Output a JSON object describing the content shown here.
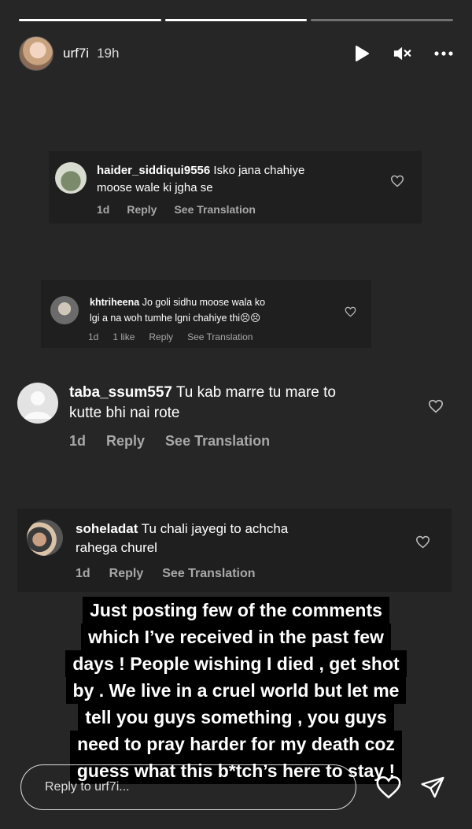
{
  "story": {
    "progress": [
      1.0,
      1.0,
      0.0
    ],
    "username": "urf7i",
    "time": "19h"
  },
  "comments": [
    {
      "user": "haider_siddiqui9556",
      "text1": "Isko jana chahiye",
      "text2": "moose wale ki jgha se",
      "time": "1d",
      "likes": "",
      "reply": "Reply",
      "translate": "See Translation"
    },
    {
      "user": "khtriheena",
      "text1": "Jo goli sidhu moose wala ko",
      "text2": "lgi a na woh tumhe lgni chahiye thi😣😣",
      "time": "1d",
      "likes": "1 like",
      "reply": "Reply",
      "translate": "See Translation"
    },
    {
      "user": "taba_ssum557",
      "text1": "Tu kab marre tu mare to",
      "text2": "kutte bhi nai rote",
      "time": "1d",
      "likes": "",
      "reply": "Reply",
      "translate": "See Translation"
    },
    {
      "user": "soheladat",
      "text1": "Tu chali jayegi to achcha",
      "text2": "rahega churel",
      "time": "1d",
      "likes": "",
      "reply": "Reply",
      "translate": "See Translation"
    }
  ],
  "caption": [
    "Just posting few of the comments",
    "which I’ve received in the past few",
    "days ! People wishing I died , get shot",
    "by . We live in a cruel world but let me",
    "tell you guys something , you guys",
    "need to pray harder for my death coz",
    "guess what this b*tch’s here to stay !"
  ],
  "reply_bar": {
    "placeholder": "Reply to urf7i..."
  },
  "colors": {
    "background": "#262626",
    "card": "#1f1f1f",
    "meta": "#a8a8a8"
  }
}
